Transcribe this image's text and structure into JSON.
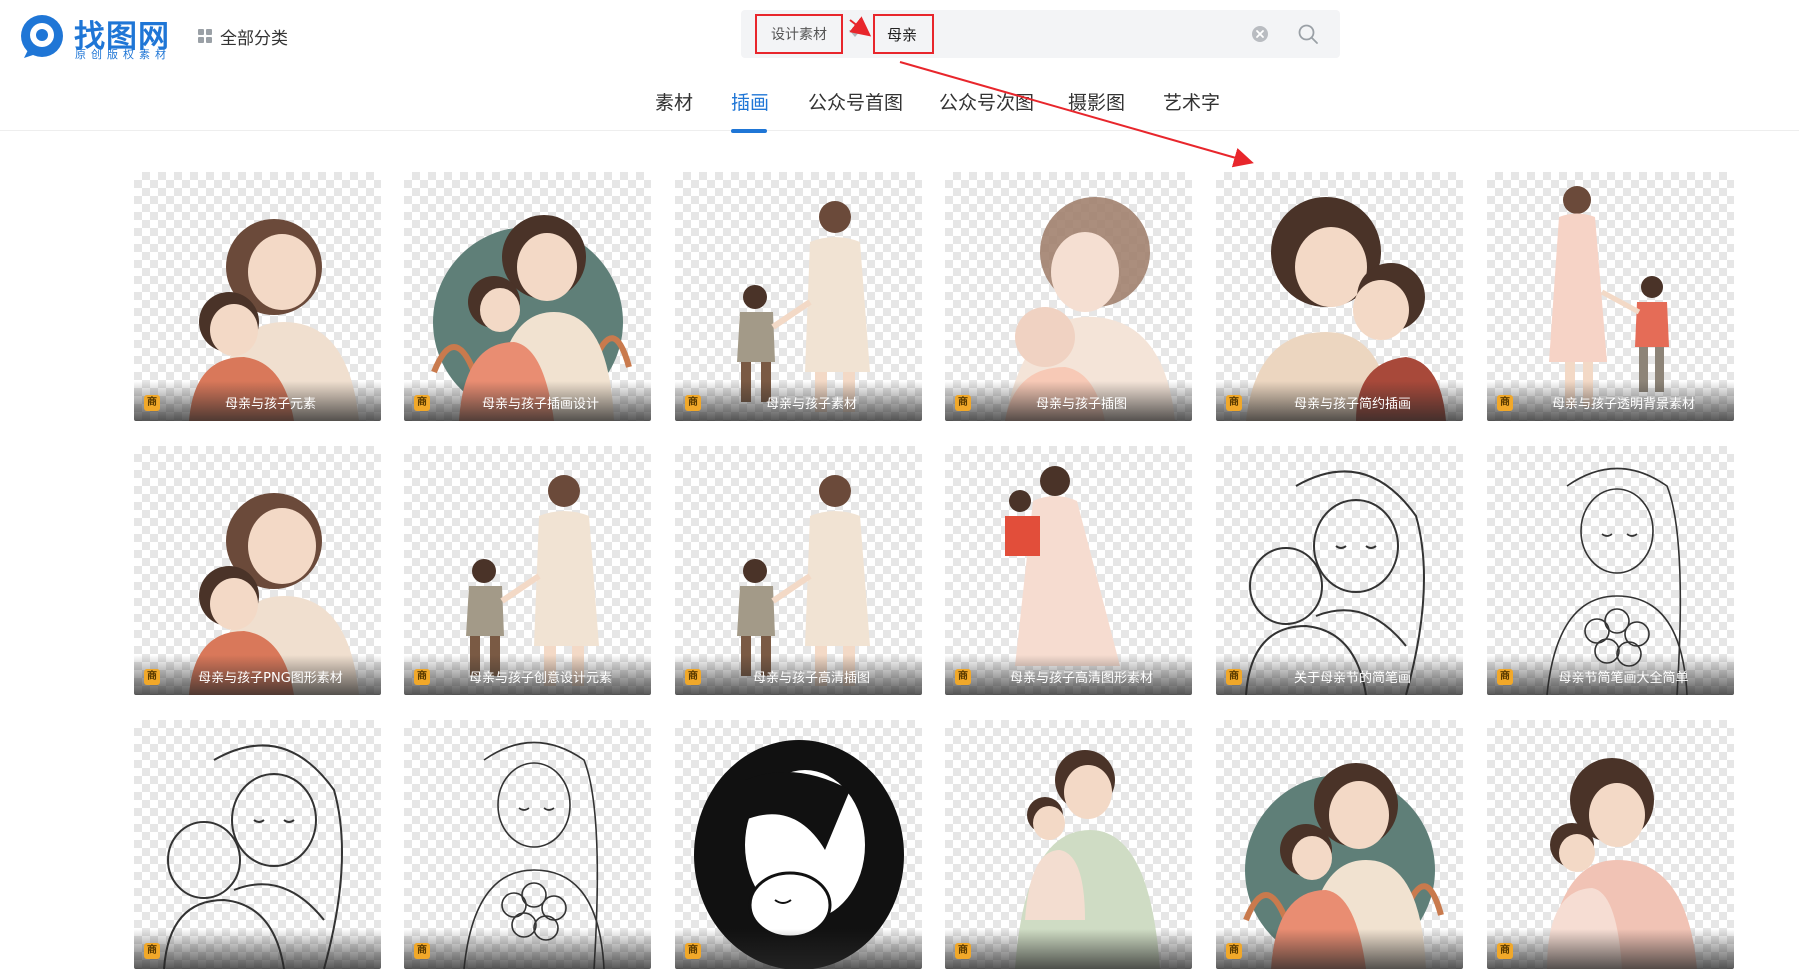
{
  "brand": {
    "name": "找图网",
    "tagline": "原创版权素材",
    "color": "#1f76d6"
  },
  "nav": {
    "all_categories": "全部分类"
  },
  "search": {
    "type_label": "设计素材",
    "query": "母亲",
    "placeholder": ""
  },
  "tabs": [
    {
      "label": "素材",
      "active": false
    },
    {
      "label": "插画",
      "active": true
    },
    {
      "label": "公众号首图",
      "active": false
    },
    {
      "label": "公众号次图",
      "active": false
    },
    {
      "label": "摄影图",
      "active": false
    },
    {
      "label": "艺术字",
      "active": false
    }
  ],
  "badge_label": "商",
  "results": [
    {
      "title": "母亲与孩子元素",
      "style": "hug-warm"
    },
    {
      "title": "母亲与孩子插画设计",
      "style": "hug-floral"
    },
    {
      "title": "母亲与孩子素材",
      "style": "walk-back"
    },
    {
      "title": "母亲与孩子插图",
      "style": "hug-soft"
    },
    {
      "title": "母亲与孩子简约插画",
      "style": "hug-cheek"
    },
    {
      "title": "母亲与孩子透明背景素材",
      "style": "walk-side"
    },
    {
      "title": "母亲与孩子PNG图形素材",
      "style": "hug-warm"
    },
    {
      "title": "母亲与孩子创意设计元素",
      "style": "walk-back"
    },
    {
      "title": "母亲与孩子高清插图",
      "style": "walk-back"
    },
    {
      "title": "母亲与孩子高清图形素材",
      "style": "carry"
    },
    {
      "title": "关于母亲节的简笔画",
      "style": "line-hug"
    },
    {
      "title": "母亲节简笔画大全简单",
      "style": "line-flowers"
    },
    {
      "title": "",
      "style": "line-hug"
    },
    {
      "title": "",
      "style": "line-flowers"
    },
    {
      "title": "",
      "style": "silhouette"
    },
    {
      "title": "",
      "style": "hug-green"
    },
    {
      "title": "",
      "style": "hug-floral"
    },
    {
      "title": "",
      "style": "hug-pink"
    }
  ],
  "colors": {
    "accent": "#1f76d6",
    "annotation_red": "#e8262c",
    "badge": "#f1a829"
  }
}
